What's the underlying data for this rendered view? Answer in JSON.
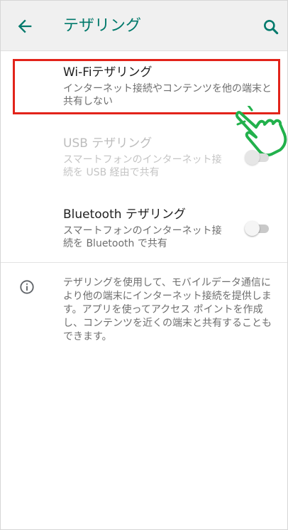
{
  "appbar": {
    "title": "テザリング",
    "back_icon": "arrow-back-icon",
    "search_icon": "search-icon"
  },
  "wifi": {
    "title": "Wi-Fiテザリング",
    "subtitle": "インターネット接続やコンテンツを他の端末と共有しない"
  },
  "usb": {
    "title": "USB テザリング",
    "subtitle": "スマートフォンのインターネット接続を USB 経由で共有",
    "enabled": false,
    "on": false
  },
  "bluetooth": {
    "title": "Bluetooth テザリング",
    "subtitle": "スマートフォンのインターネット接続を Bluetooth で共有",
    "enabled": true,
    "on": false
  },
  "info": {
    "icon": "info-icon",
    "text": "テザリングを使用して、モバイルデータ通信により他の端末にインターネット接続を提供します。アプリを使ってアクセス ポイントを作成し、コンテンツを近くの端末と共有することもできます。"
  },
  "colors": {
    "accent": "#00796b",
    "highlight": "#e2231a",
    "pointer": "#22b14c"
  }
}
